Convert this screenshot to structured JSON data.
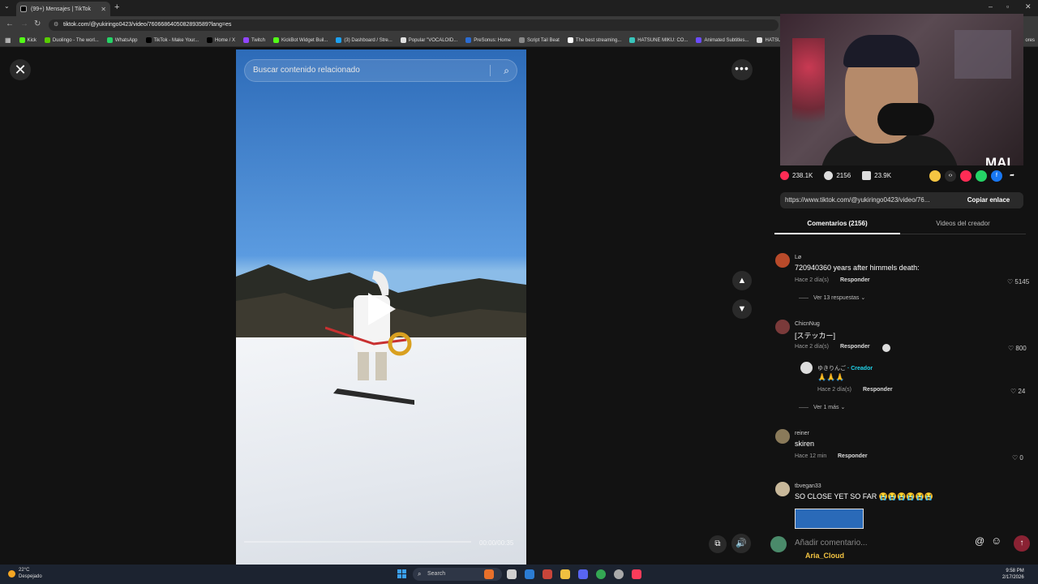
{
  "browser": {
    "tab_title": "(99+) Mensajes | TikTok",
    "url": "tiktok.com/@yukiringo0423/video/7606686405082893589?lang=es",
    "bookmarks": [
      "Kick",
      "Duolingo - The worl...",
      "WhatsApp",
      "TikTok - Make Your...",
      "Home / X",
      "Twitch",
      "KickBot Widget Buil...",
      "(3) Dashboard / Stre...",
      "Popular \"VOCALOID...",
      "PreSonus: Home",
      "Script Tail Beat",
      "The best streaming...",
      "HATSUNE MIKU: CO...",
      "Animated Subtitles...",
      "HATSUNE"
    ],
    "bookmark_colors": [
      "#53fc18",
      "#58cc02",
      "#25d366",
      "#000000",
      "#000000",
      "#9146ff",
      "#53fc18",
      "#1da1f2",
      "#e0e0e0",
      "#2b6cd1",
      "#888888",
      "#ffffff",
      "#39c5bb",
      "#6b4cff",
      "#e0e0e0"
    ],
    "bookmarks_overflow": "ores"
  },
  "video": {
    "search_placeholder": "Buscar contenido relacionado",
    "time": "00:00/00:35"
  },
  "webcam": {
    "label": "MAI"
  },
  "stats": {
    "likes": "238.1K",
    "comments": "2156",
    "saves": "23.9K"
  },
  "link": {
    "url": "https://www.tiktok.com/@yukiringo0423/video/76...",
    "copy_label": "Copiar enlace"
  },
  "tabs": {
    "comments": "Comentarios (2156)",
    "creator": "Videos del creador"
  },
  "comments": [
    {
      "name": "Lø",
      "text": "720940360 years after himmels death:",
      "time": "Hace 2 día(s)",
      "reply": "Responder",
      "likes": "5145",
      "more": "Ver 13 respuestas",
      "avatar_color": "#b84a2a"
    },
    {
      "name": "ChicnNug",
      "text": "[ステッカー]",
      "time": "Hace 2 día(s)",
      "reply": "Responder",
      "likes": "800",
      "avatar_color": "#7a3a3a",
      "nested": {
        "name": "ゆきりんご",
        "creator_tag": "· Creador",
        "text": "🙏🙏🙏",
        "time": "Hace 2 día(s)",
        "reply": "Responder",
        "likes": "24",
        "avatar_color": "#ddd"
      },
      "more": "Ver 1 más"
    },
    {
      "name": "reiner",
      "text": "skiren",
      "time": "Hace 12 min",
      "reply": "Responder",
      "likes": "0",
      "avatar_color": "#8a7a5a"
    },
    {
      "name": "tbvegan33",
      "text": "SO CLOSE YET SO FAR 😭😭😭😭😭😭",
      "avatar_color": "#c8b89a"
    }
  ],
  "comment_input": {
    "placeholder": "Añadir comentario...",
    "overlay_user": "Aria_Cloud"
  },
  "taskbar": {
    "temp": "22°C",
    "weather": "Despejado",
    "search": "Search",
    "time": "9:58 PM",
    "date": "2/17/2026"
  }
}
